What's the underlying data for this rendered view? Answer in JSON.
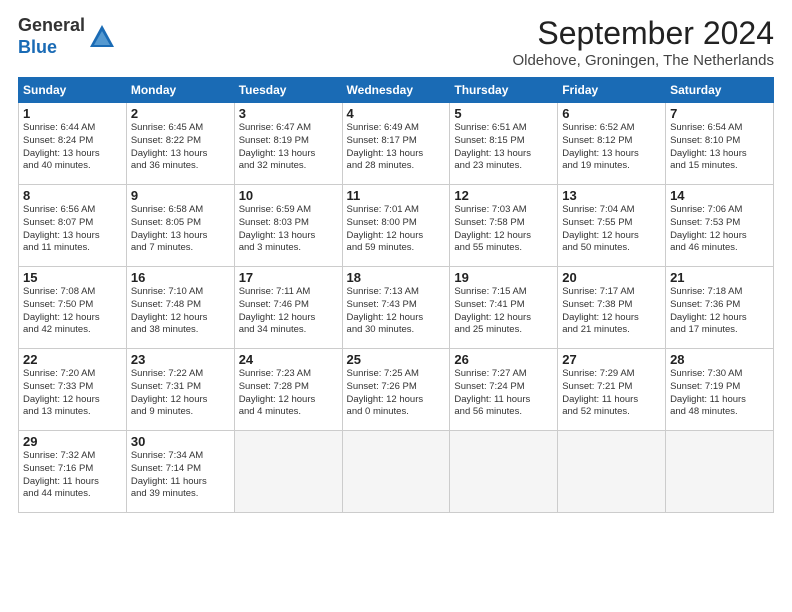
{
  "header": {
    "logo_general": "General",
    "logo_blue": "Blue",
    "title": "September 2024",
    "subtitle": "Oldehove, Groningen, The Netherlands"
  },
  "weekdays": [
    "Sunday",
    "Monday",
    "Tuesday",
    "Wednesday",
    "Thursday",
    "Friday",
    "Saturday"
  ],
  "weeks": [
    [
      {
        "day": "1",
        "info": "Sunrise: 6:44 AM\nSunset: 8:24 PM\nDaylight: 13 hours\nand 40 minutes."
      },
      {
        "day": "2",
        "info": "Sunrise: 6:45 AM\nSunset: 8:22 PM\nDaylight: 13 hours\nand 36 minutes."
      },
      {
        "day": "3",
        "info": "Sunrise: 6:47 AM\nSunset: 8:19 PM\nDaylight: 13 hours\nand 32 minutes."
      },
      {
        "day": "4",
        "info": "Sunrise: 6:49 AM\nSunset: 8:17 PM\nDaylight: 13 hours\nand 28 minutes."
      },
      {
        "day": "5",
        "info": "Sunrise: 6:51 AM\nSunset: 8:15 PM\nDaylight: 13 hours\nand 23 minutes."
      },
      {
        "day": "6",
        "info": "Sunrise: 6:52 AM\nSunset: 8:12 PM\nDaylight: 13 hours\nand 19 minutes."
      },
      {
        "day": "7",
        "info": "Sunrise: 6:54 AM\nSunset: 8:10 PM\nDaylight: 13 hours\nand 15 minutes."
      }
    ],
    [
      {
        "day": "8",
        "info": "Sunrise: 6:56 AM\nSunset: 8:07 PM\nDaylight: 13 hours\nand 11 minutes."
      },
      {
        "day": "9",
        "info": "Sunrise: 6:58 AM\nSunset: 8:05 PM\nDaylight: 13 hours\nand 7 minutes."
      },
      {
        "day": "10",
        "info": "Sunrise: 6:59 AM\nSunset: 8:03 PM\nDaylight: 13 hours\nand 3 minutes."
      },
      {
        "day": "11",
        "info": "Sunrise: 7:01 AM\nSunset: 8:00 PM\nDaylight: 12 hours\nand 59 minutes."
      },
      {
        "day": "12",
        "info": "Sunrise: 7:03 AM\nSunset: 7:58 PM\nDaylight: 12 hours\nand 55 minutes."
      },
      {
        "day": "13",
        "info": "Sunrise: 7:04 AM\nSunset: 7:55 PM\nDaylight: 12 hours\nand 50 minutes."
      },
      {
        "day": "14",
        "info": "Sunrise: 7:06 AM\nSunset: 7:53 PM\nDaylight: 12 hours\nand 46 minutes."
      }
    ],
    [
      {
        "day": "15",
        "info": "Sunrise: 7:08 AM\nSunset: 7:50 PM\nDaylight: 12 hours\nand 42 minutes."
      },
      {
        "day": "16",
        "info": "Sunrise: 7:10 AM\nSunset: 7:48 PM\nDaylight: 12 hours\nand 38 minutes."
      },
      {
        "day": "17",
        "info": "Sunrise: 7:11 AM\nSunset: 7:46 PM\nDaylight: 12 hours\nand 34 minutes."
      },
      {
        "day": "18",
        "info": "Sunrise: 7:13 AM\nSunset: 7:43 PM\nDaylight: 12 hours\nand 30 minutes."
      },
      {
        "day": "19",
        "info": "Sunrise: 7:15 AM\nSunset: 7:41 PM\nDaylight: 12 hours\nand 25 minutes."
      },
      {
        "day": "20",
        "info": "Sunrise: 7:17 AM\nSunset: 7:38 PM\nDaylight: 12 hours\nand 21 minutes."
      },
      {
        "day": "21",
        "info": "Sunrise: 7:18 AM\nSunset: 7:36 PM\nDaylight: 12 hours\nand 17 minutes."
      }
    ],
    [
      {
        "day": "22",
        "info": "Sunrise: 7:20 AM\nSunset: 7:33 PM\nDaylight: 12 hours\nand 13 minutes."
      },
      {
        "day": "23",
        "info": "Sunrise: 7:22 AM\nSunset: 7:31 PM\nDaylight: 12 hours\nand 9 minutes."
      },
      {
        "day": "24",
        "info": "Sunrise: 7:23 AM\nSunset: 7:28 PM\nDaylight: 12 hours\nand 4 minutes."
      },
      {
        "day": "25",
        "info": "Sunrise: 7:25 AM\nSunset: 7:26 PM\nDaylight: 12 hours\nand 0 minutes."
      },
      {
        "day": "26",
        "info": "Sunrise: 7:27 AM\nSunset: 7:24 PM\nDaylight: 11 hours\nand 56 minutes."
      },
      {
        "day": "27",
        "info": "Sunrise: 7:29 AM\nSunset: 7:21 PM\nDaylight: 11 hours\nand 52 minutes."
      },
      {
        "day": "28",
        "info": "Sunrise: 7:30 AM\nSunset: 7:19 PM\nDaylight: 11 hours\nand 48 minutes."
      }
    ],
    [
      {
        "day": "29",
        "info": "Sunrise: 7:32 AM\nSunset: 7:16 PM\nDaylight: 11 hours\nand 44 minutes."
      },
      {
        "day": "30",
        "info": "Sunrise: 7:34 AM\nSunset: 7:14 PM\nDaylight: 11 hours\nand 39 minutes."
      },
      {
        "day": "",
        "info": ""
      },
      {
        "day": "",
        "info": ""
      },
      {
        "day": "",
        "info": ""
      },
      {
        "day": "",
        "info": ""
      },
      {
        "day": "",
        "info": ""
      }
    ]
  ]
}
